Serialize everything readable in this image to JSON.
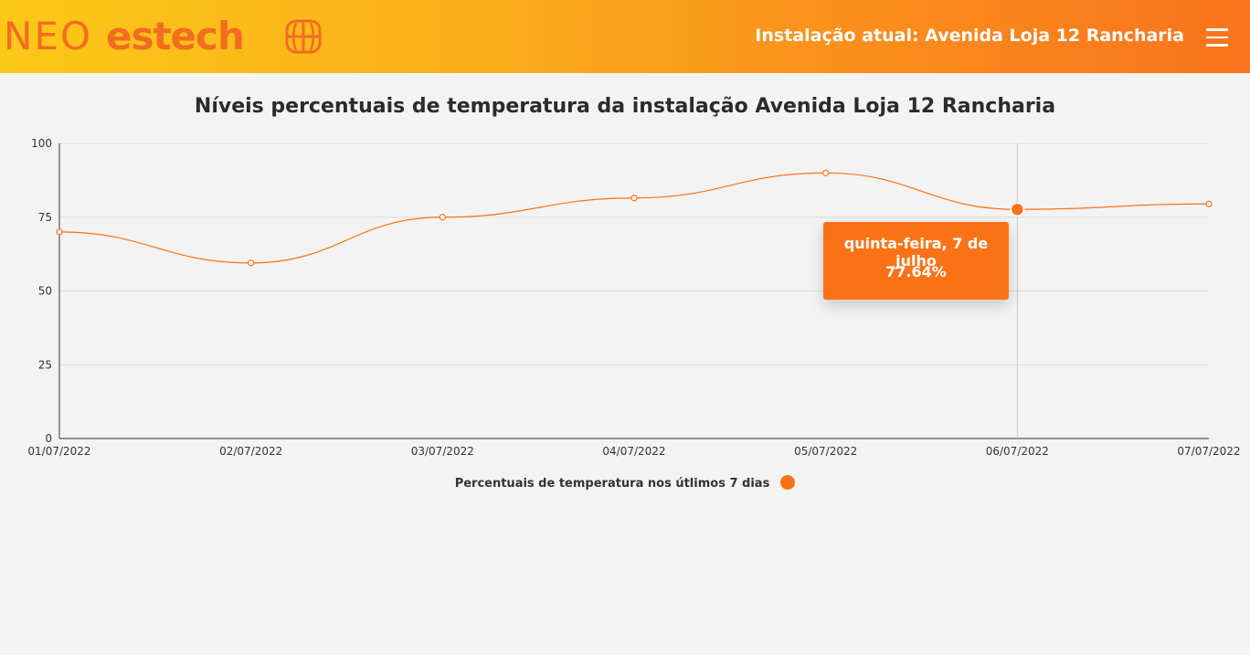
{
  "header": {
    "logo_neo": "NEO",
    "logo_estech": "estech",
    "installation_label": "Instalação atual: Avenida Loja 12 Rancharia",
    "menu_icon": "hamburger-menu-icon"
  },
  "colors": {
    "accent": "#f97316",
    "logo": "#f26c21",
    "header_gradient_start": "#fcc818",
    "header_gradient_end": "#f9731c"
  },
  "chart_data": {
    "type": "line",
    "title": "Níveis percentuais de temperatura da instalação Avenida Loja 12 Rancharia",
    "categories": [
      "01/07/2022",
      "02/07/2022",
      "03/07/2022",
      "04/07/2022",
      "05/07/2022",
      "06/07/2022",
      "07/07/2022"
    ],
    "series": [
      {
        "name": "Percentuais de temperatura nos útlimos 7 dias",
        "values": [
          70,
          59.5,
          75,
          81.5,
          90,
          77.64,
          79.5
        ]
      }
    ],
    "ylim": [
      0,
      100
    ],
    "yticks": [
      0,
      25,
      50,
      75,
      100
    ],
    "grid": true,
    "legend_position": "bottom",
    "active_index": 5,
    "tooltip": {
      "date": "quinta-feira, 7 de julho",
      "value": "77.64%"
    }
  }
}
